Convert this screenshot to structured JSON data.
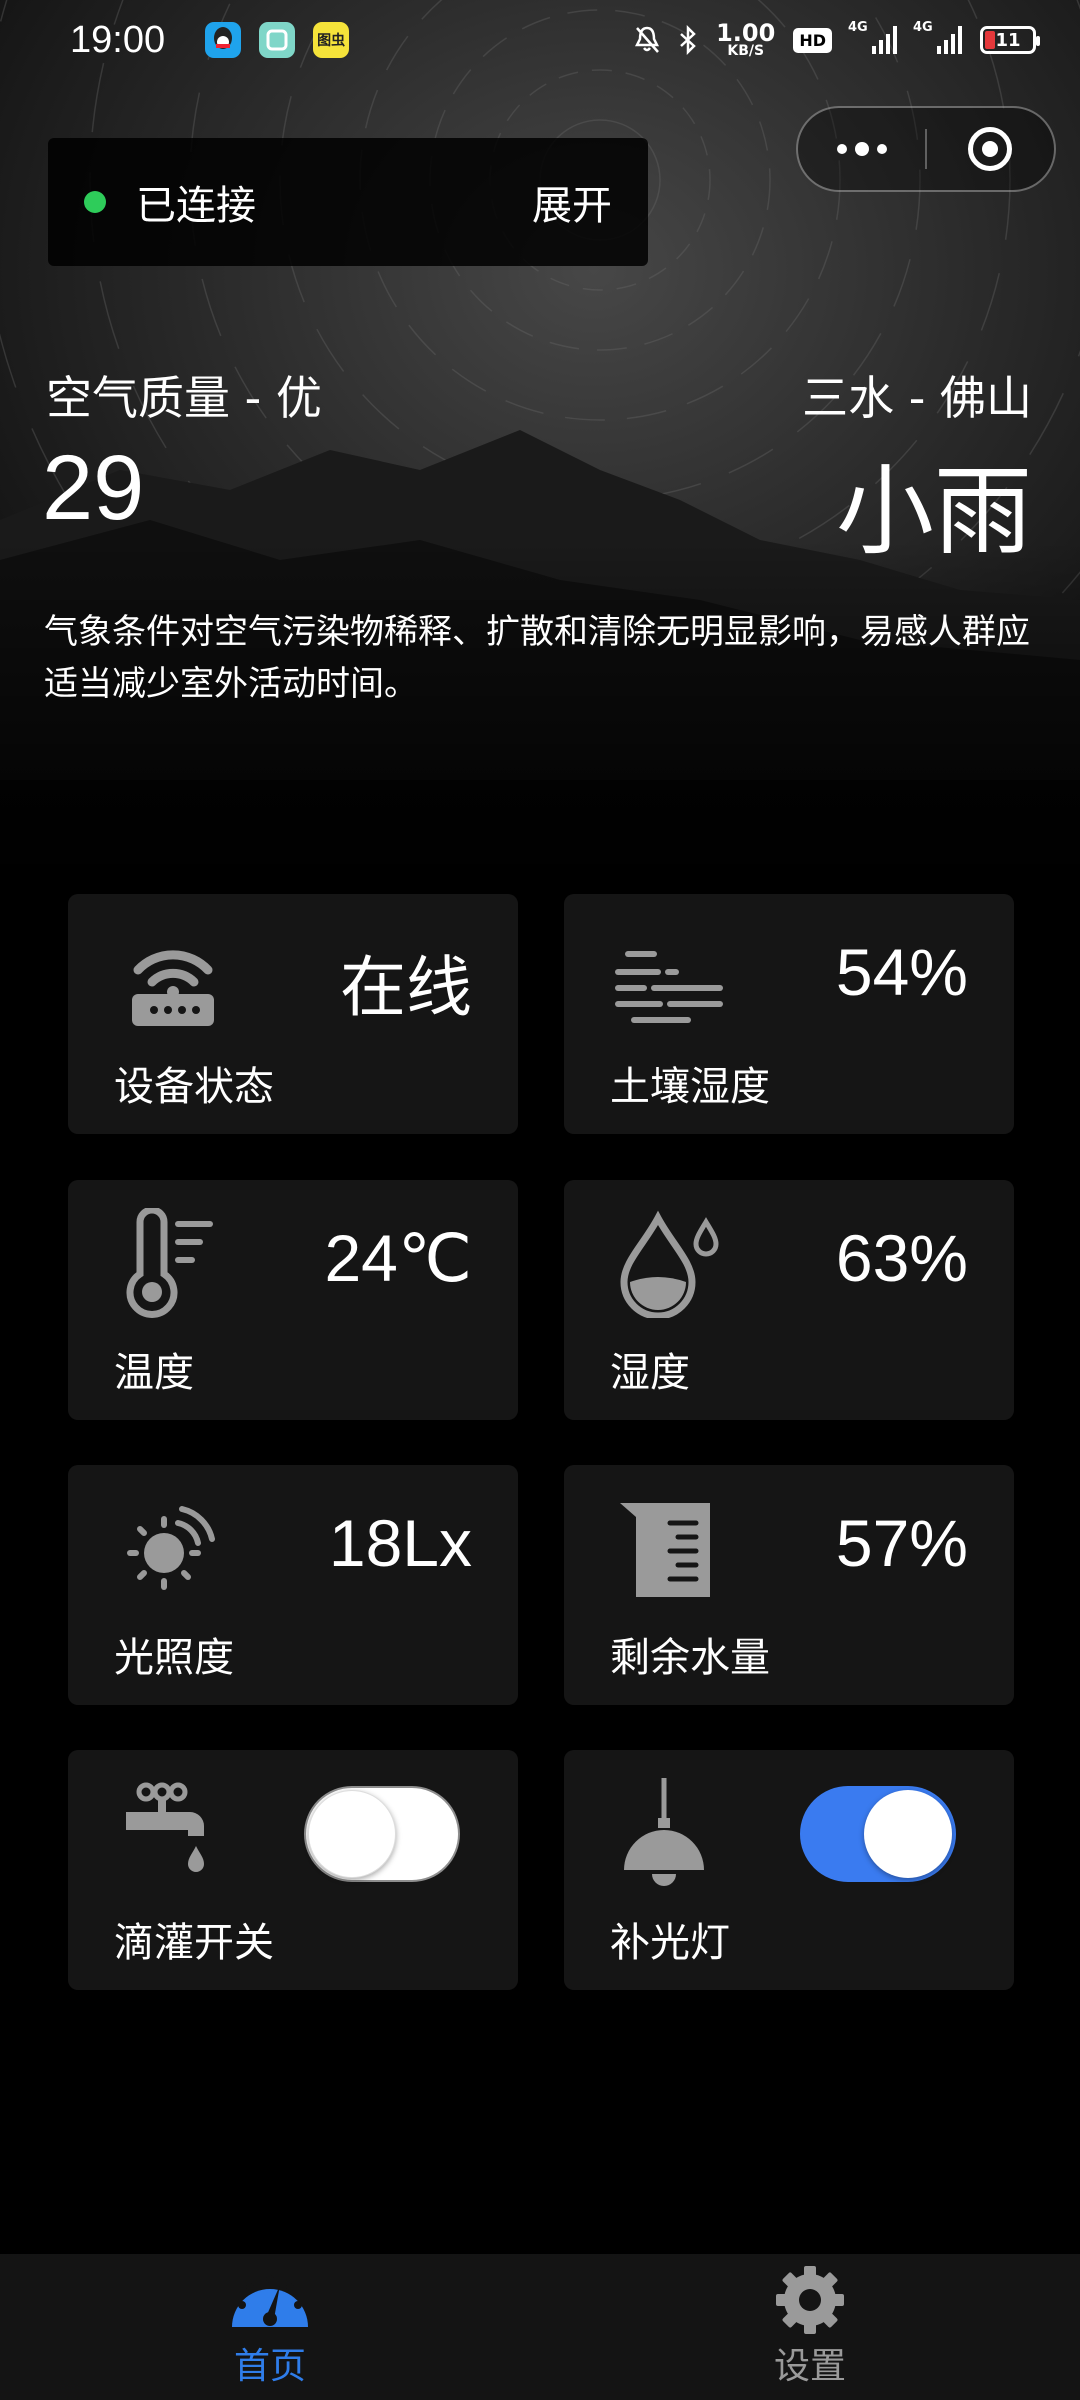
{
  "status_bar": {
    "time": "19:00",
    "app_icons": [
      {
        "name": "qq-icon",
        "color": "#1fa3ec"
      },
      {
        "name": "app-icon",
        "color": "#7fd6c8"
      },
      {
        "name": "tuchong-icon",
        "color": "#f5e33a",
        "text": "图虫"
      }
    ],
    "net_speed_value": "1.00",
    "net_speed_unit": "KB/S",
    "hd_label": "HD",
    "signal_1_label": "4G",
    "signal_2_label": "4G",
    "battery_level": "11",
    "battery_color": "#e5383b"
  },
  "connection": {
    "status": "已连接",
    "status_color": "#2ecc5a",
    "expand_label": "展开"
  },
  "weather": {
    "air_quality_label": "空气质量 - 优",
    "air_quality_value": "29",
    "city": "三水 - 佛山",
    "condition": "小雨",
    "advice": "气象条件对空气污染物稀释、扩散和清除无明显影响，易感人群应适当减少室外活动时间。"
  },
  "cards": {
    "device_status": {
      "value": "在线",
      "label": "设备状态",
      "icon": "router-icon"
    },
    "soil_humidity": {
      "value": "54%",
      "label": "土壤湿度",
      "icon": "soil-humidity-icon"
    },
    "temperature": {
      "value": "24℃",
      "label": "温度",
      "icon": "thermometer-icon"
    },
    "humidity": {
      "value": "63%",
      "label": "湿度",
      "icon": "water-drop-icon"
    },
    "illuminance": {
      "value": "18Lx",
      "label": "光照度",
      "icon": "sun-icon"
    },
    "water_remaining": {
      "value": "57%",
      "label": "剩余水量",
      "icon": "beaker-icon"
    },
    "drip_irrigation": {
      "label": "滴灌开关",
      "icon": "faucet-icon",
      "state": "off"
    },
    "fill_light": {
      "label": "补光灯",
      "icon": "lamp-icon",
      "state": "on"
    }
  },
  "tab_bar": {
    "tabs": [
      {
        "label": "首页",
        "icon": "dashboard-icon",
        "active": true
      },
      {
        "label": "设置",
        "icon": "gear-icon",
        "active": false
      }
    ],
    "active_color": "#2f7dea",
    "inactive_color": "#9a9a9a"
  }
}
